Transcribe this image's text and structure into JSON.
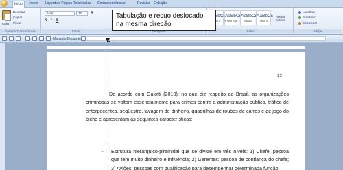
{
  "tabs": [
    "Início",
    "Inserir",
    "Layout da Página",
    "Referências",
    "Correspondências",
    "Revisão",
    "Exibição"
  ],
  "clipboard": {
    "paste_label": "Colar",
    "cut_label": "Recortar",
    "copy_label": "Copiar",
    "format_painter_label": "Pincel",
    "group_label": "Área de Transferência"
  },
  "font": {
    "name": "Arial",
    "size": "12",
    "group_label": "Fonte",
    "grow": "A",
    "bold": "N",
    "italic": "I",
    "underline": "S"
  },
  "paragraph": {
    "group_label": "Parágrafo"
  },
  "styles": {
    "items": [
      {
        "sample": "AaBbCc",
        "name": "Título 1"
      },
      {
        "sample": "AaBbCc",
        "name": "¶ Sem Esp..."
      },
      {
        "sample": "AaBbCc",
        "name": "Título 2"
      },
      {
        "sample": "AaBbCc",
        "name": "Título 3"
      }
    ],
    "change_label": "Alterar Estilos",
    "group_label": "Estilo"
  },
  "editing": {
    "find_label": "Localizar",
    "replace_label": "Substituir",
    "select_label": "Selecionar",
    "group_label": "Edição"
  },
  "toolbar": {
    "document_map_label": "Mapa do Documento"
  },
  "callout": {
    "line1": "Tabulação e recuo deslocado",
    "line2": "na mesma direcão"
  },
  "document": {
    "page_number": "13",
    "paragraph_1": "De acordo com Gaiotti (2010), no que diz respeito ao Brasil, as organizações criminosas se voltam essencialmente para crimes contra a administração pública, tráfico de entorpecentes, seqüestro, lavagem de dinheiro, quadrilhas de roubos de carros e de jogo do bicho e apresentam as seguintes características:",
    "bullet_dash": "-",
    "bullet_1": "Estrutura hierárquico-piramidal que se divide em três níveis: 1) Chefe: pessoa que tem muito dinheiro e influência; 2) Gerentes: pessoa de confiança do chefe; 3) Aviões: pessoas com qualificação para desempenhar determinada função."
  },
  "colors": {
    "ribbon_bg": "#dfe9f5",
    "workspace_bg": "#9aaec9",
    "accent": "#15428b"
  }
}
